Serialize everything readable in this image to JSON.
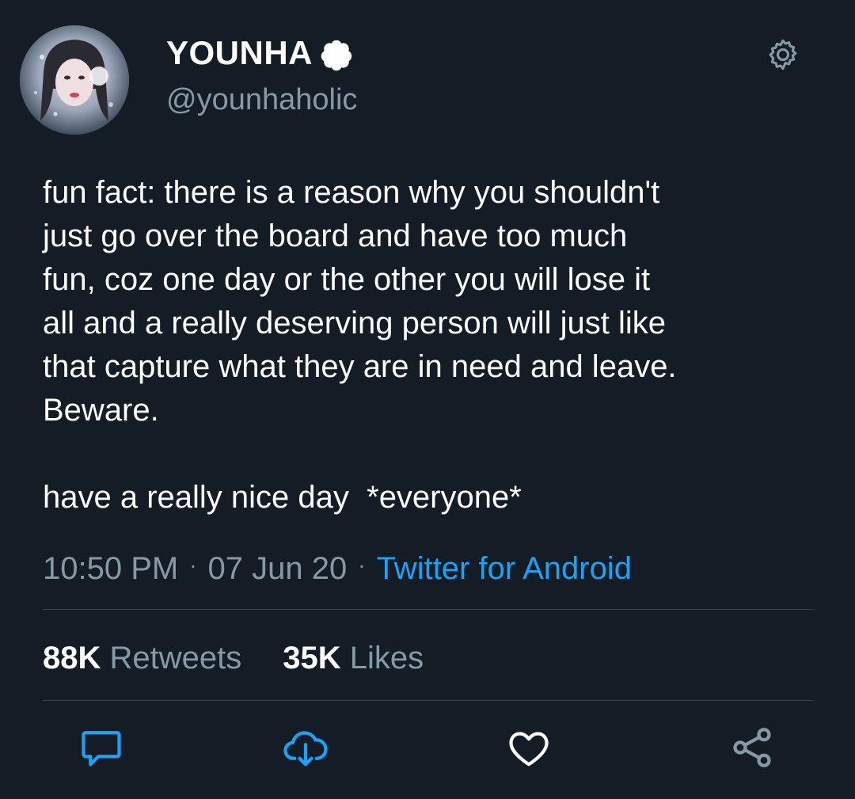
{
  "user": {
    "display_name": "YOUNHA",
    "handle": "@younhaholic",
    "verified_icon": "verified-badge-icon",
    "avatar_icon": "profile-photo"
  },
  "header": {
    "settings_icon": "gear-icon"
  },
  "tweet": {
    "lines": [
      "fun fact: there is a reason why you shouldn't",
      "just go over the board and have too much",
      "fun, coz one day or the other you will lose it",
      "all and a really deserving person will just like",
      "that capture what they are in need and leave.",
      "Beware."
    ],
    "closing": "have a really nice day  *everyone*"
  },
  "meta": {
    "time": "10:50 PM",
    "separator": "·",
    "date": "07 Jun 20",
    "source": "Twitter for Android"
  },
  "stats": {
    "retweets_count": "88K",
    "retweets_label": "Retweets",
    "likes_count": "35K",
    "likes_label": "Likes"
  },
  "actions": [
    {
      "name": "reply",
      "icon": "reply-icon"
    },
    {
      "name": "retweet",
      "icon": "retweet-icon"
    },
    {
      "name": "like",
      "icon": "heart-icon"
    },
    {
      "name": "share",
      "icon": "share-icon"
    }
  ],
  "colors": {
    "background": "#141d26",
    "text": "#ffffff",
    "muted": "#8899a6",
    "accent": "#1da1f2",
    "divider": "#38444d"
  }
}
